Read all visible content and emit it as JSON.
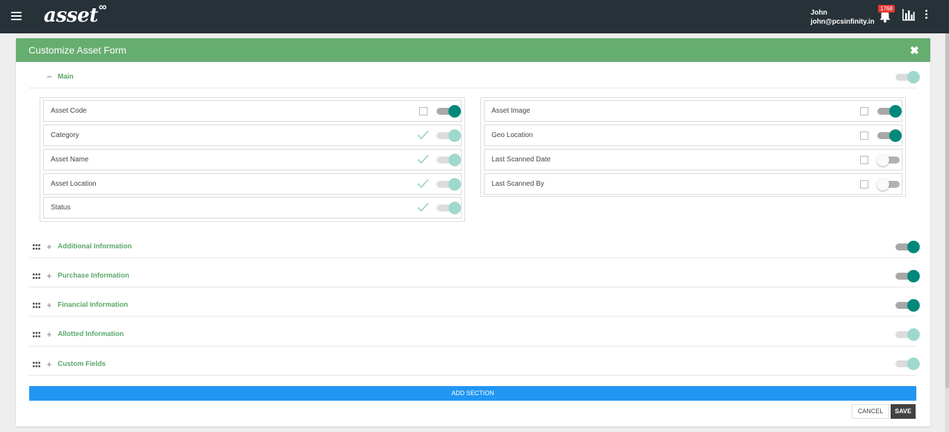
{
  "header": {
    "logo_text": "asset",
    "user_name": "John",
    "user_email": "john@pcsinfinity.in",
    "notification_count": "1768"
  },
  "form": {
    "title": "Customize Asset Form",
    "close_icon": "✖",
    "main_section": {
      "title": "Main",
      "collapse_symbol": "−",
      "left_fields": [
        {
          "label": "Asset Code",
          "state": "on",
          "control": "checkbox"
        },
        {
          "label": "Category",
          "state": "disabled",
          "control": "check-mark"
        },
        {
          "label": "Asset Name",
          "state": "disabled",
          "control": "check-mark"
        },
        {
          "label": "Asset Location",
          "state": "disabled",
          "control": "check-mark"
        },
        {
          "label": "Status",
          "state": "disabled",
          "control": "check-mark"
        }
      ],
      "right_fields": [
        {
          "label": "Asset Image",
          "state": "on",
          "control": "checkbox"
        },
        {
          "label": "Geo Location",
          "state": "on",
          "control": "checkbox"
        },
        {
          "label": "Last Scanned Date",
          "state": "off",
          "control": "checkbox"
        },
        {
          "label": "Last Scanned By",
          "state": "off",
          "control": "checkbox"
        }
      ]
    },
    "sections": [
      {
        "title": "Additional Information",
        "state": "on"
      },
      {
        "title": "Purchase Information",
        "state": "on"
      },
      {
        "title": "Financial Information",
        "state": "on"
      },
      {
        "title": "Allotted Information",
        "state": "disabled"
      },
      {
        "title": "Custom Fields",
        "state": "disabled"
      }
    ],
    "expand_symbol": "+",
    "add_section_label": "ADD SECTION",
    "cancel_label": "CANCEL",
    "save_label": "SAVE"
  },
  "colors": {
    "topbar": "#263238",
    "header_green": "#66ad70",
    "toggle_on": "#00897b",
    "primary_blue": "#2196f3"
  }
}
